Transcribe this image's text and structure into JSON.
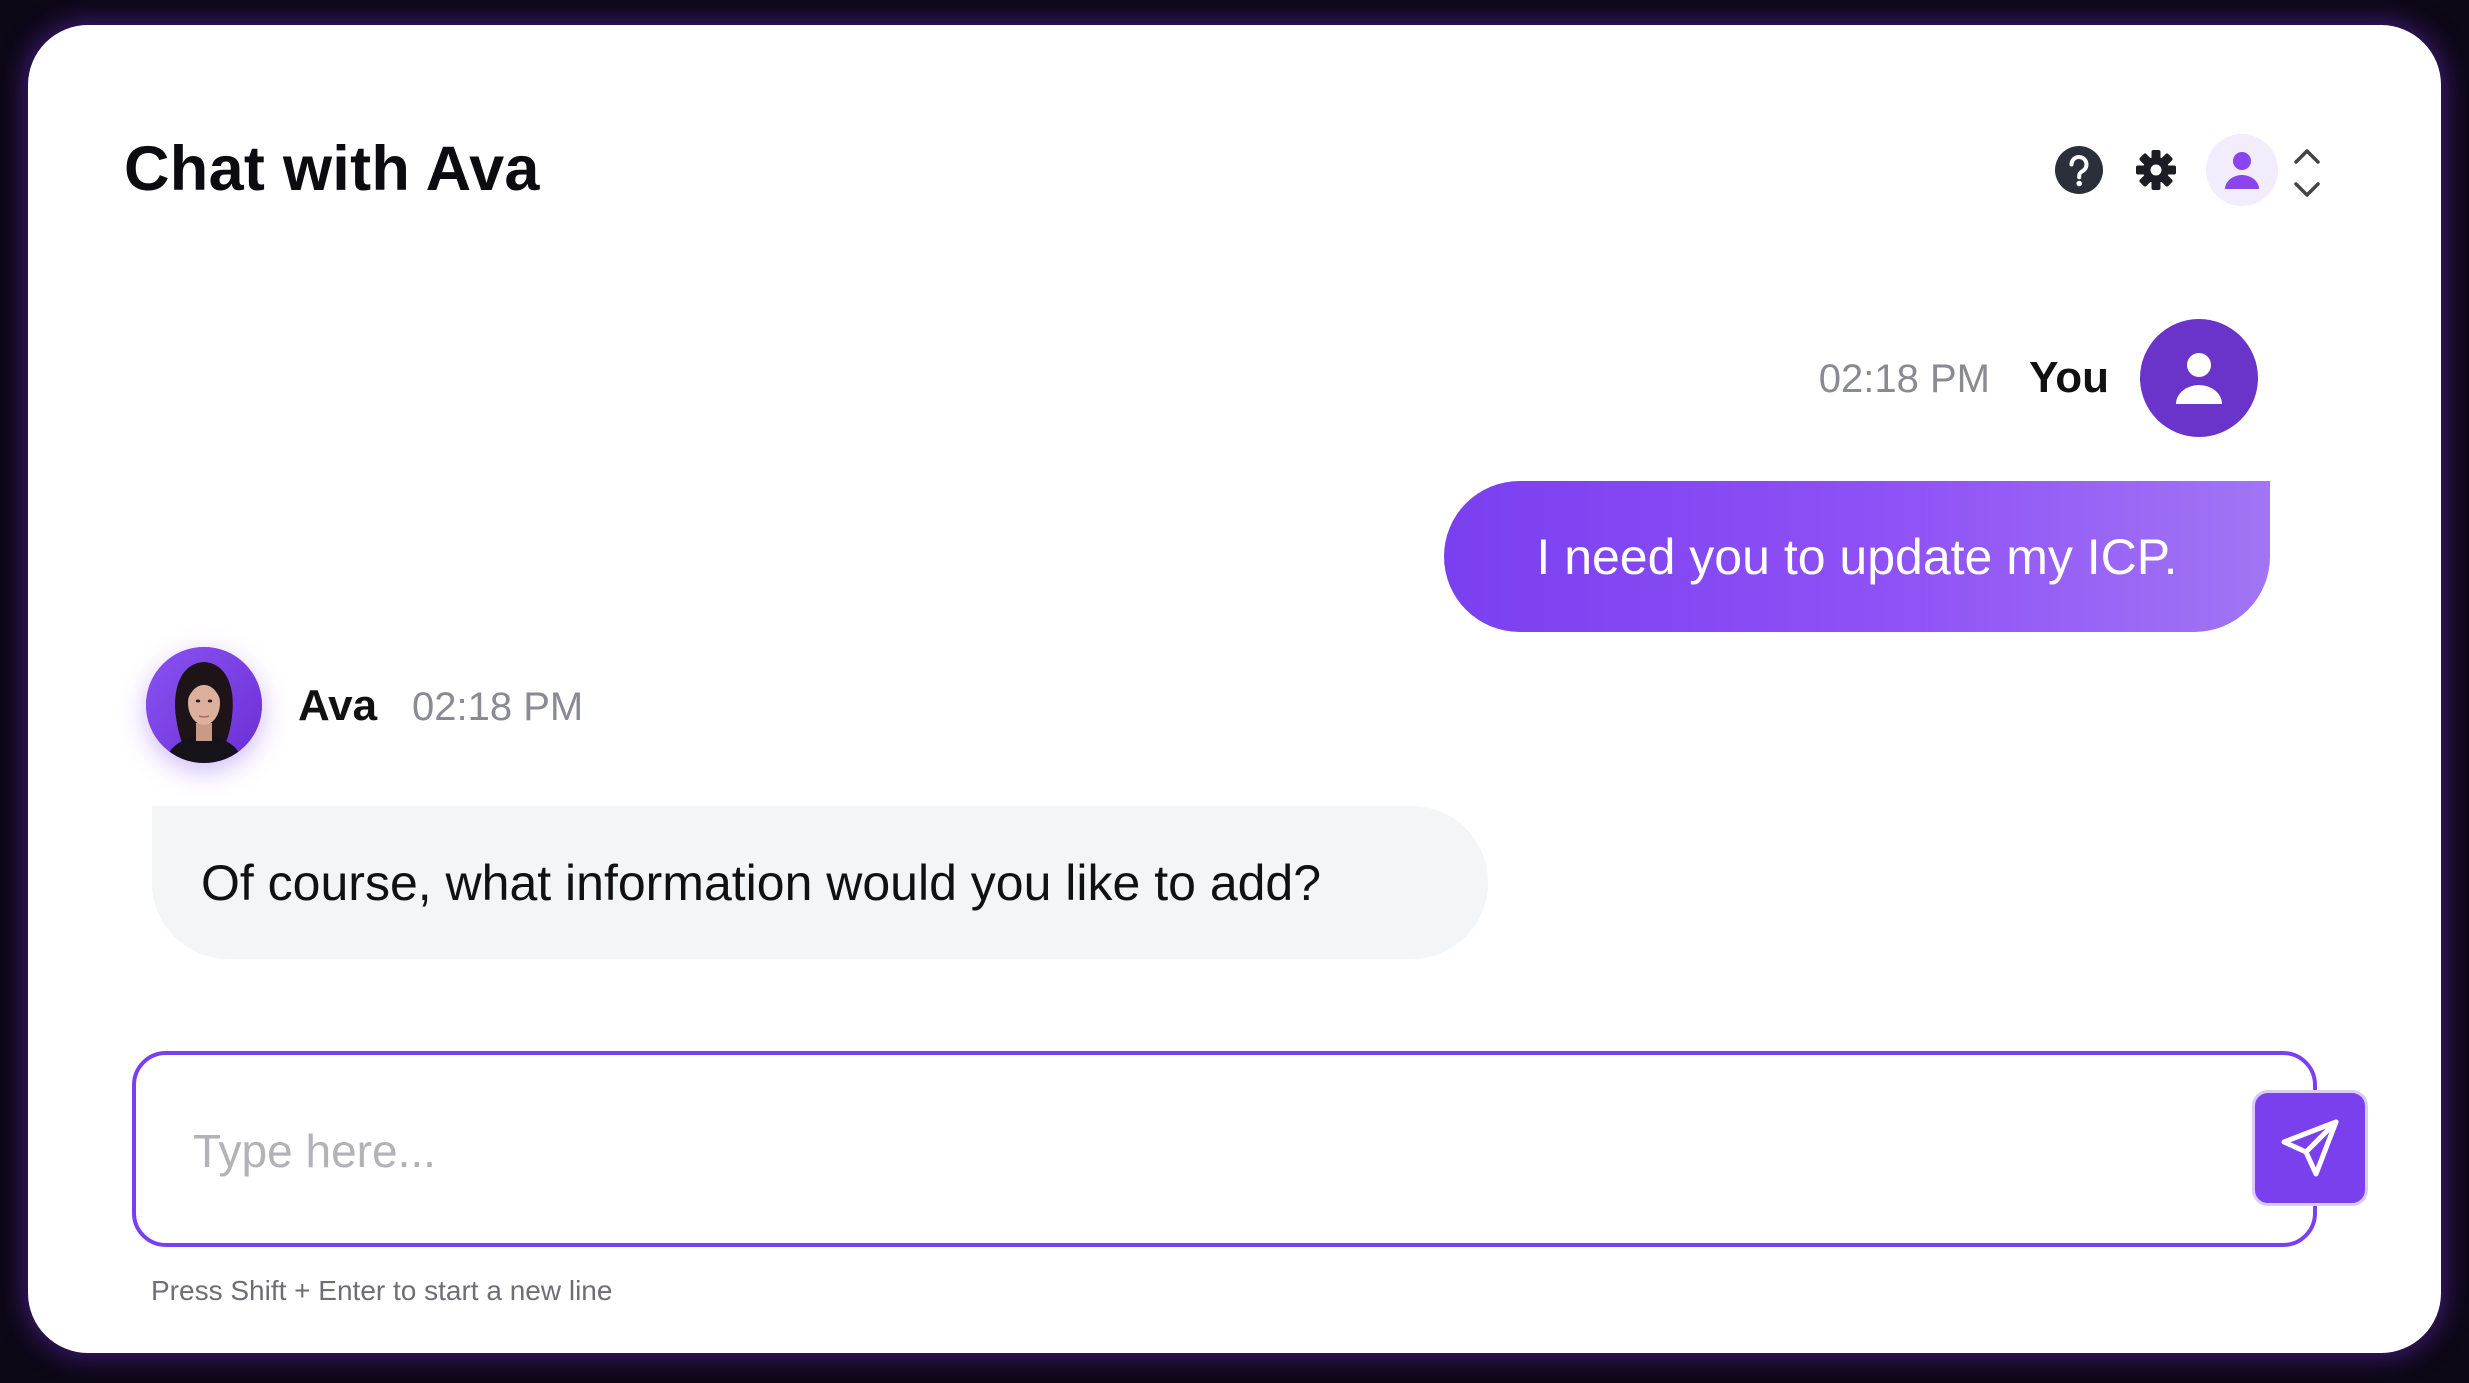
{
  "header": {
    "title": "Chat with Ava",
    "icons": [
      "help-icon",
      "gear-icon",
      "user-icon",
      "chevrons-up-down-icon"
    ]
  },
  "messages": [
    {
      "sender": "You",
      "time": "02:18 PM",
      "text": "I need you to update my ICP."
    },
    {
      "sender": "Ava",
      "time": "02:18 PM",
      "text": "Of course, what information would you like to add?"
    }
  ],
  "composer": {
    "placeholder": "Type here...",
    "value": "",
    "hint": "Press Shift + Enter to start a new line",
    "send_icon": "send-icon"
  },
  "colors": {
    "accent": "#7a3ff0",
    "avatar_user": "#6a33c9",
    "bubble_ava": "#f4f5f7",
    "muted_text": "#8a8a93"
  }
}
